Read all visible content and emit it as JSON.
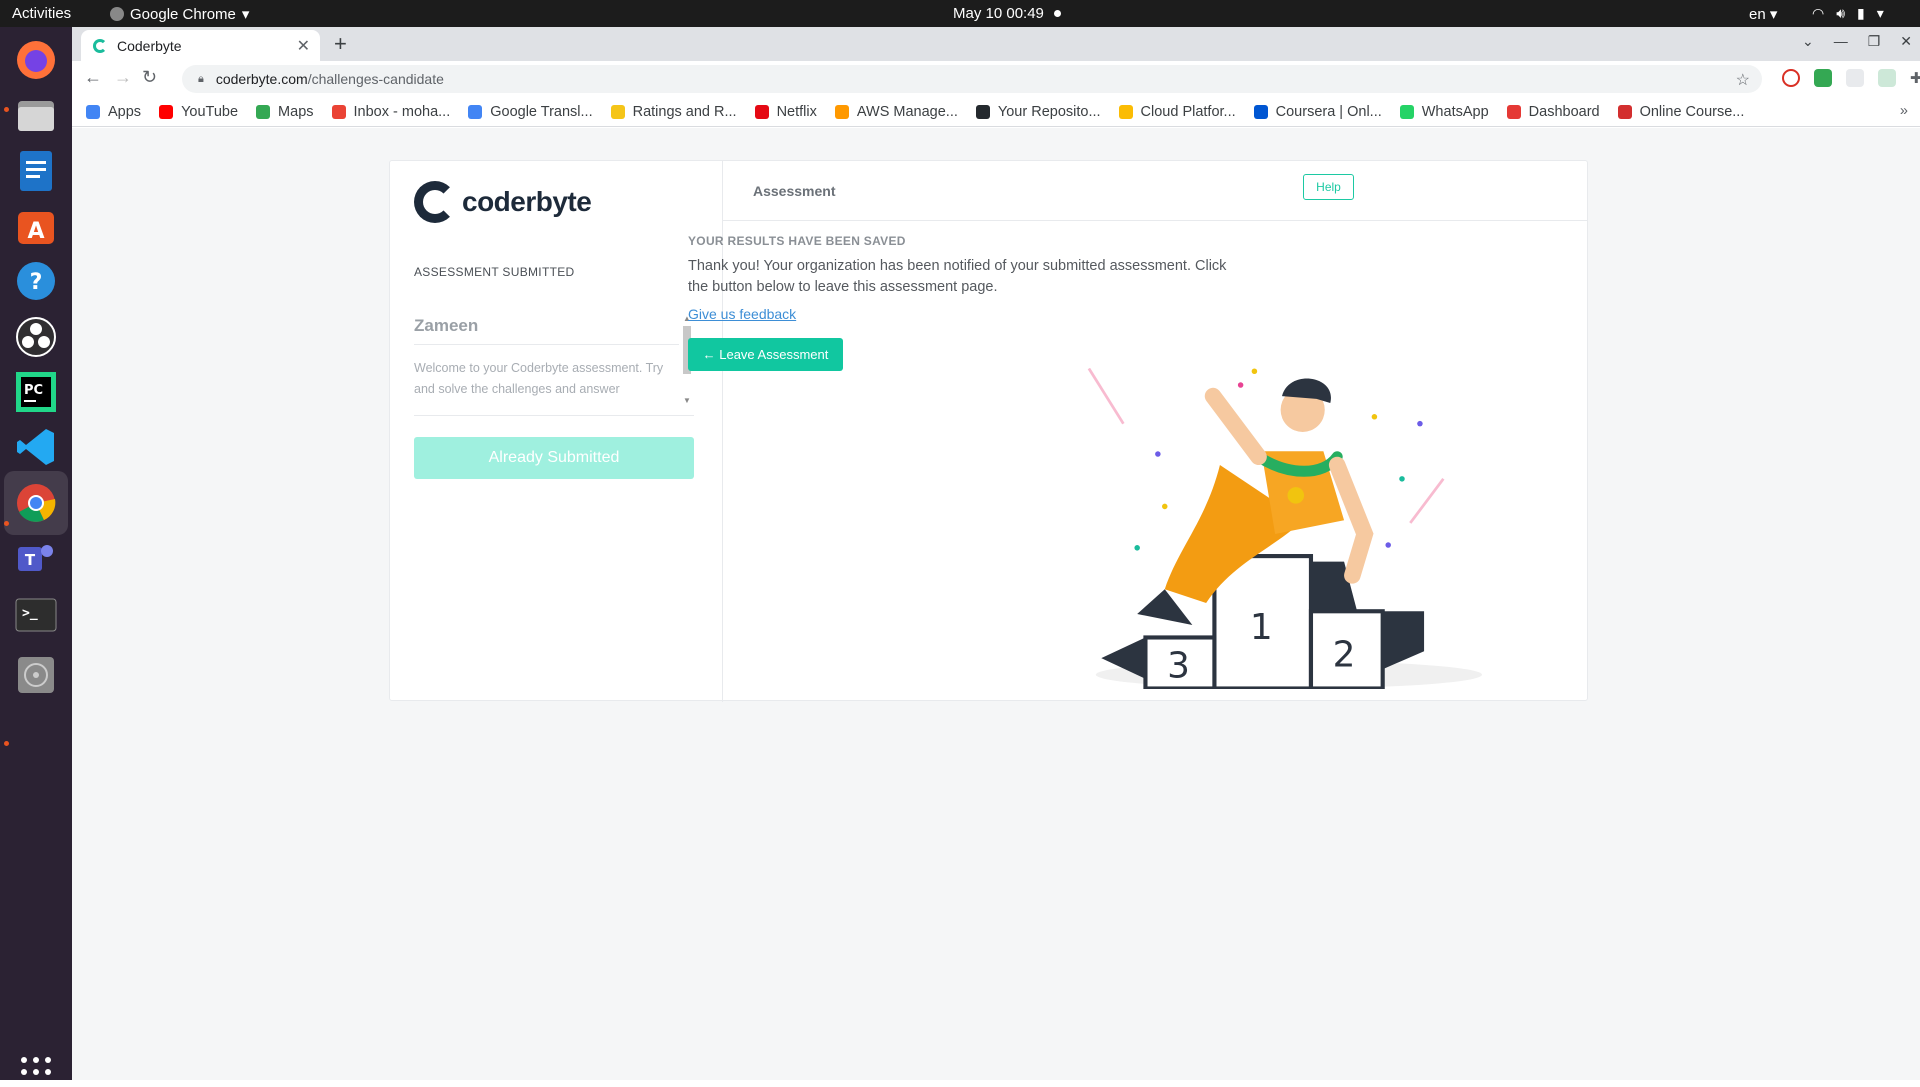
{
  "system": {
    "activities": "Activities",
    "app_name": "Google Chrome",
    "clock": "May 10  00:49",
    "lang": "en"
  },
  "browser": {
    "tab_title": "Coderbyte",
    "url_host": "coderbyte.com",
    "url_path": "/challenges-candidate",
    "bookmarks": [
      {
        "label": "Apps",
        "color": "#4285f4"
      },
      {
        "label": "YouTube",
        "color": "#ff0000"
      },
      {
        "label": "Maps",
        "color": "#34a853"
      },
      {
        "label": "Inbox - moha...",
        "color": "#ea4335"
      },
      {
        "label": "Google Transl...",
        "color": "#4285f4"
      },
      {
        "label": "Ratings and R...",
        "color": "#f5c518"
      },
      {
        "label": "Netflix",
        "color": "#e50914"
      },
      {
        "label": "AWS Manage...",
        "color": "#ff9900"
      },
      {
        "label": "Your Reposito...",
        "color": "#24292e"
      },
      {
        "label": "Cloud Platfor...",
        "color": "#fbbc04"
      },
      {
        "label": "Coursera | Onl...",
        "color": "#0056d2"
      },
      {
        "label": "WhatsApp",
        "color": "#25d366"
      },
      {
        "label": "Dashboard",
        "color": "#e53935"
      },
      {
        "label": "Online Course...",
        "color": "#d32f2f"
      }
    ]
  },
  "left_panel": {
    "logo_text": "coderbyte",
    "status": "ASSESSMENT SUBMITTED",
    "candidate_name": "Zameen",
    "welcome_text": "Welcome to your Coderbyte assessment. Try and solve the challenges and answer",
    "submit_button": "Already Submitted"
  },
  "main": {
    "header_title": "Assessment",
    "help_button": "Help",
    "saved_heading": "YOUR RESULTS HAVE BEEN SAVED",
    "thanks_text": "Thank you! Your organization has been notified of your submitted assessment. Click the button below to leave this assessment page.",
    "feedback_link": "Give us feedback",
    "leave_button": "← Leave Assessment",
    "podium": {
      "first": "1",
      "second": "2",
      "third": "3"
    }
  },
  "colors": {
    "accent": "#11c7a0",
    "accent_light": "#9ff0df",
    "link": "#3d8ed6",
    "brand_dark": "#1d2a3a"
  }
}
